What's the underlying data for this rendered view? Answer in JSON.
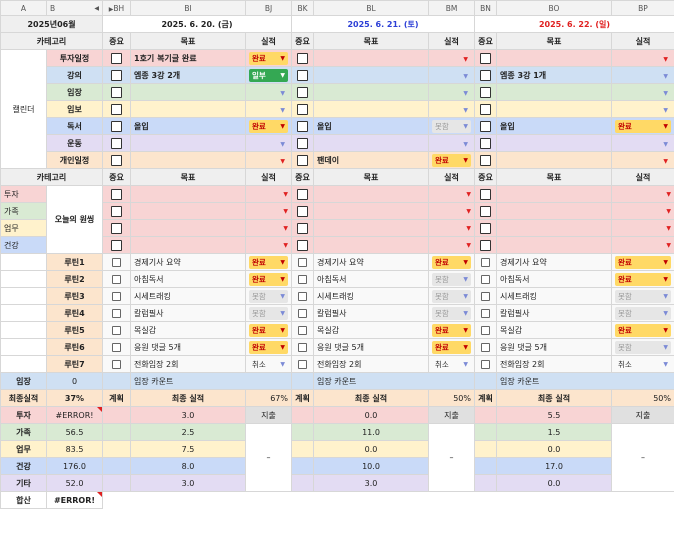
{
  "columns": [
    "A",
    "B",
    "BH",
    "BI",
    "BJ",
    "BK",
    "BL",
    "BM",
    "BN",
    "BO",
    "BP"
  ],
  "col_nav_glyph": "◀ ▶",
  "month_label": "2025년06월",
  "dates": [
    {
      "label": "2025. 6. 20. (금)",
      "color": "#222222"
    },
    {
      "label": "2025. 6. 21. (토)",
      "color": "#2c3fd6"
    },
    {
      "label": "2025. 6. 22. (일)",
      "color": "#e02020"
    }
  ],
  "headers": {
    "category": "카테고리",
    "importance": "중요",
    "goal": "목표",
    "result": "실적"
  },
  "calendar_group_label": "캘린더",
  "calendar_rows": [
    {
      "label": "투자일정",
      "bg": "bg-pink",
      "days": [
        {
          "goal": "1호기 복기글 완료",
          "result": "완료",
          "style": "p-orange"
        },
        {
          "goal": "",
          "result": "",
          "style": "p-none"
        },
        {
          "goal": "",
          "result": "",
          "style": "p-none"
        }
      ]
    },
    {
      "label": "강의",
      "bg": "bg-blue",
      "days": [
        {
          "goal": "엠종 3강 2개",
          "result": "일부",
          "style": "p-green"
        },
        {
          "goal": "",
          "result": "",
          "style": "p-none"
        },
        {
          "goal": "엠종 3강 1개",
          "result": "",
          "style": "p-none"
        }
      ]
    },
    {
      "label": "임장",
      "bg": "bg-green",
      "days": [
        {
          "goal": "",
          "result": "",
          "style": "p-none"
        },
        {
          "goal": "",
          "result": "",
          "style": "p-none"
        },
        {
          "goal": "",
          "result": "",
          "style": "p-none"
        }
      ]
    },
    {
      "label": "임보",
      "bg": "bg-yellow",
      "days": [
        {
          "goal": "",
          "result": "",
          "style": "p-none"
        },
        {
          "goal": "",
          "result": "",
          "style": "p-none"
        },
        {
          "goal": "",
          "result": "",
          "style": "p-none"
        }
      ]
    },
    {
      "label": "독서",
      "bg": "bg-lblue",
      "days": [
        {
          "goal": "올입",
          "result": "완료",
          "style": "p-orange"
        },
        {
          "goal": "올입",
          "result": "못함",
          "style": "p-gray"
        },
        {
          "goal": "올입",
          "result": "완료",
          "style": "p-orange"
        }
      ]
    },
    {
      "label": "운동",
      "bg": "bg-lav",
      "days": [
        {
          "goal": "",
          "result": "",
          "style": "p-none"
        },
        {
          "goal": "",
          "result": "",
          "style": "p-none"
        },
        {
          "goal": "",
          "result": "",
          "style": "p-none"
        }
      ]
    },
    {
      "label": "개인일정",
      "bg": "bg-peach",
      "days": [
        {
          "goal": "",
          "result": "",
          "style": "p-none"
        },
        {
          "goal": "팬데이",
          "result": "완료",
          "style": "p-orange"
        },
        {
          "goal": "",
          "result": "",
          "style": "p-none"
        }
      ]
    }
  ],
  "today_side": [
    {
      "label": "투자",
      "bg": "bg-pink"
    },
    {
      "label": "가족",
      "bg": "bg-green"
    },
    {
      "label": "업무",
      "bg": "bg-yellow"
    },
    {
      "label": "건강",
      "bg": "bg-lblue"
    }
  ],
  "today_label": "오늘의 원씽",
  "routines": [
    {
      "label": "루틴1",
      "goal": "경제기사 요약",
      "results": [
        {
          "t": "완료",
          "s": "p-orange"
        },
        {
          "t": "완료",
          "s": "p-orange"
        },
        {
          "t": "완료",
          "s": "p-orange"
        }
      ]
    },
    {
      "label": "루틴2",
      "goal": "아침독서",
      "results": [
        {
          "t": "완료",
          "s": "p-orange"
        },
        {
          "t": "못함",
          "s": "p-gray"
        },
        {
          "t": "완료",
          "s": "p-orange"
        }
      ]
    },
    {
      "label": "루틴3",
      "goal": "시세트래킹",
      "results": [
        {
          "t": "못함",
          "s": "p-gray"
        },
        {
          "t": "못함",
          "s": "p-gray"
        },
        {
          "t": "못함",
          "s": "p-gray"
        }
      ]
    },
    {
      "label": "루틴4",
      "goal": "칼럼필사",
      "results": [
        {
          "t": "못함",
          "s": "p-gray"
        },
        {
          "t": "못함",
          "s": "p-gray"
        },
        {
          "t": "못함",
          "s": "p-gray"
        }
      ]
    },
    {
      "label": "루틴5",
      "goal": "목실감",
      "results": [
        {
          "t": "완료",
          "s": "p-orange"
        },
        {
          "t": "완료",
          "s": "p-orange"
        },
        {
          "t": "완료",
          "s": "p-orange"
        }
      ]
    },
    {
      "label": "루틴6",
      "goal": "응원 댓글 5개",
      "results": [
        {
          "t": "완료",
          "s": "p-orange"
        },
        {
          "t": "완료",
          "s": "p-orange"
        },
        {
          "t": "못함",
          "s": "p-gray"
        }
      ]
    },
    {
      "label": "루틴7",
      "goal": "전화임장 2회",
      "results": [
        {
          "t": "취소",
          "s": "p-none"
        },
        {
          "t": "취소",
          "s": "p-none"
        },
        {
          "t": "취소",
          "s": "p-none"
        }
      ]
    }
  ],
  "imjang": {
    "label": "임장",
    "value": "0",
    "count_label": "임장 카운트"
  },
  "final": {
    "label": "최종실적",
    "value": "37%",
    "plan_label": "계획",
    "final_label": "최종 실적",
    "day_pct": [
      "67%",
      "50%",
      "50%"
    ],
    "status_label": "지출",
    "dash": "–"
  },
  "final_rows": [
    {
      "label": "투자",
      "value": "#ERROR!",
      "bg": "bg-pink",
      "err": true,
      "days": [
        "3.0",
        "0.0",
        "5.5"
      ]
    },
    {
      "label": "가족",
      "value": "56.5",
      "bg": "bg-green",
      "err": false,
      "days": [
        "2.5",
        "11.0",
        "1.5"
      ]
    },
    {
      "label": "업무",
      "value": "83.5",
      "bg": "bg-yellow",
      "err": false,
      "days": [
        "7.5",
        "0.0",
        "0.0"
      ]
    },
    {
      "label": "건강",
      "value": "176.0",
      "bg": "bg-lblue",
      "err": false,
      "days": [
        "8.0",
        "10.0",
        "17.0"
      ]
    },
    {
      "label": "기타",
      "value": "52.0",
      "bg": "bg-lav",
      "err": false,
      "days": [
        "3.0",
        "3.0",
        "0.0"
      ]
    }
  ],
  "total": {
    "label": "합산",
    "value": "#ERROR!"
  },
  "row_cut": "후크"
}
